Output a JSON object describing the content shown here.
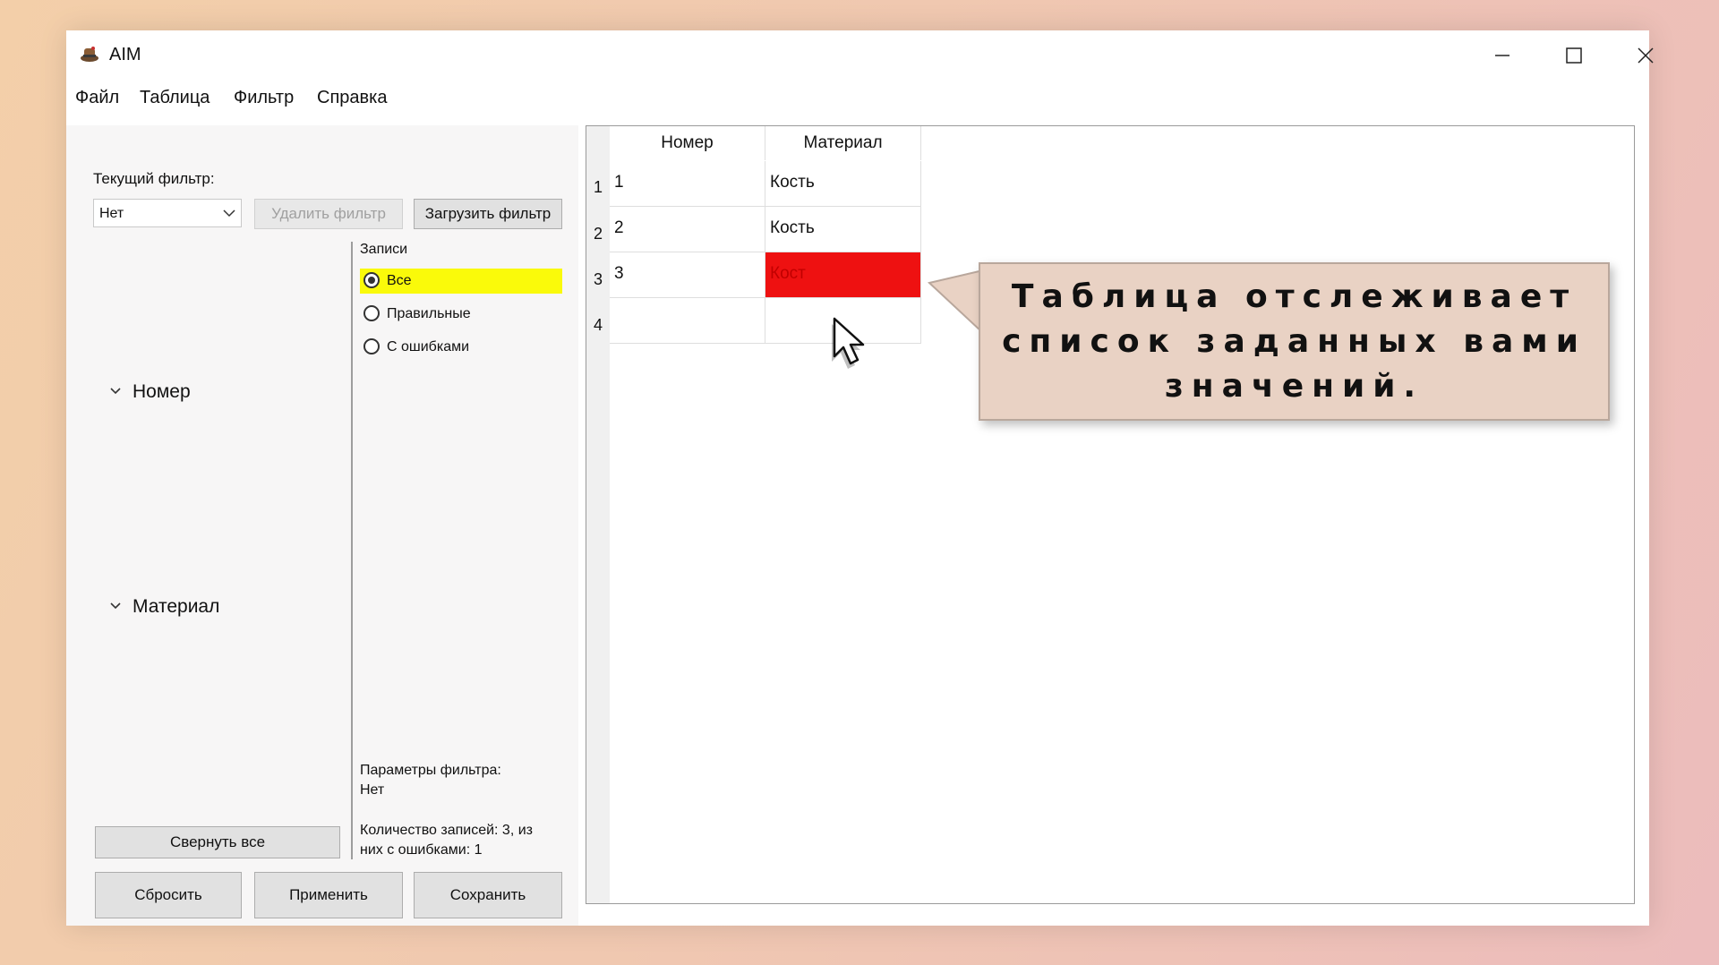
{
  "window": {
    "title": "AIM",
    "controls": [
      "minimize",
      "maximize",
      "close"
    ]
  },
  "menu": [
    "Файл",
    "Таблица",
    "Фильтр",
    "Справка"
  ],
  "filter_panel": {
    "current_filter_label": "Текущий фильтр:",
    "current_filter_value": "Нет",
    "delete_filter_button": "Удалить фильтр",
    "load_filter_button": "Загрузить фильтр",
    "groups": [
      "Номер",
      "Материал"
    ],
    "records_title": "Записи",
    "records_options": [
      {
        "label": "Все",
        "selected": true
      },
      {
        "label": "Правильные",
        "selected": false
      },
      {
        "label": "С ошибками",
        "selected": false
      }
    ],
    "params_label": "Параметры фильтра:",
    "params_value": "Нет",
    "count_line1": "Количество записей: 3, из",
    "count_line2": "них с ошибками: 1",
    "collapse_all_button": "Свернуть все",
    "reset_button": "Сбросить",
    "apply_button": "Применить",
    "save_button": "Сохранить"
  },
  "table": {
    "columns": [
      "Номер",
      "Материал"
    ],
    "rows": [
      {
        "num": "1",
        "cells": [
          "1",
          "Кость"
        ],
        "error": false
      },
      {
        "num": "2",
        "cells": [
          "2",
          "Кость"
        ],
        "error": false
      },
      {
        "num": "3",
        "cells": [
          "3",
          "Кост"
        ],
        "error": true
      },
      {
        "num": "4",
        "cells": [
          "",
          ""
        ],
        "error": false
      }
    ]
  },
  "callout": {
    "line1": "Таблица отслеживает",
    "line2": "список заданных вами",
    "line3": "значений."
  },
  "colors": {
    "selected_radio_bg": "#fafa0a",
    "error_cell_bg": "#ee1111",
    "callout_bg": "#e9d2c4"
  },
  "icons": [
    "app-icon",
    "minimize-icon",
    "maximize-icon",
    "close-icon",
    "chevron-down-icon",
    "mouse-cursor-icon"
  ]
}
